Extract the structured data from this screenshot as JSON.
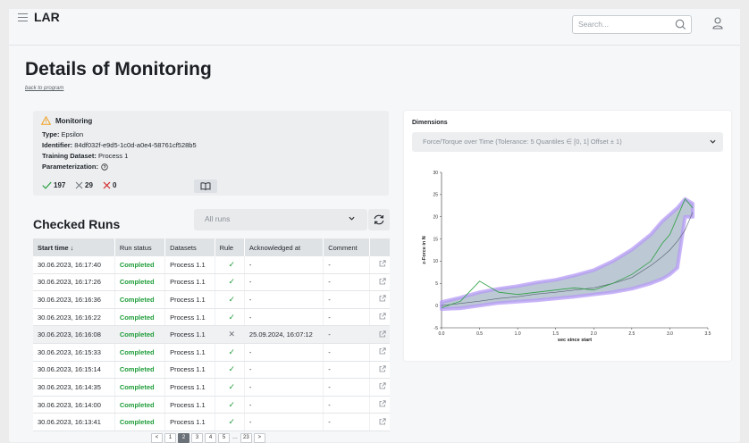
{
  "header": {
    "app_title": "LAR",
    "search_placeholder": "Search...",
    "menu_icon": "menu-icon",
    "search_icon": "search-icon",
    "user_icon": "user-icon"
  },
  "page": {
    "title": "Details of Monitoring",
    "back_link": "back to program"
  },
  "monitoring": {
    "heading": "Monitoring",
    "type_label": "Type:",
    "type_value": "Epsilon",
    "identifier_label": "Identifier:",
    "identifier_value": "84df032f-e9d5-1c0d-a0e4-58761cf528b5",
    "training_label": "Training Dataset:",
    "training_value": "Process 1",
    "param_label": "Parameterization:",
    "stats": {
      "checked": "197",
      "unchecked": "29",
      "failed": "0"
    },
    "colors": {
      "warning": "#f0a020",
      "ok": "#1f9d3a",
      "fail": "#d62828",
      "neutral": "#6b7178"
    }
  },
  "checked_runs": {
    "title": "Checked Runs",
    "filter_value": "All runs",
    "columns": [
      "Start time ↓",
      "Run status",
      "Datasets",
      "Rule",
      "Acknowledged at",
      "Comment"
    ],
    "rows": [
      {
        "start": "30.06.2023, 16:17:40",
        "status": "Completed",
        "dataset": "Process 1.1",
        "rule": "✓",
        "ack": "-",
        "comment": "-"
      },
      {
        "start": "30.06.2023, 16:17:26",
        "status": "Completed",
        "dataset": "Process 1.1",
        "rule": "✓",
        "ack": "-",
        "comment": "-"
      },
      {
        "start": "30.06.2023, 16:16:36",
        "status": "Completed",
        "dataset": "Process 1.1",
        "rule": "✓",
        "ack": "-",
        "comment": "-"
      },
      {
        "start": "30.06.2023, 16:16:22",
        "status": "Completed",
        "dataset": "Process 1.1",
        "rule": "✓",
        "ack": "-",
        "comment": "-"
      },
      {
        "start": "30.06.2023, 16:16:08",
        "status": "Completed",
        "dataset": "Process 1.1",
        "rule": "✕",
        "ack": "25.09.2024, 16:07:12",
        "comment": "-"
      },
      {
        "start": "30.06.2023, 16:15:33",
        "status": "Completed",
        "dataset": "Process 1.1",
        "rule": "✓",
        "ack": "-",
        "comment": "-"
      },
      {
        "start": "30.06.2023, 16:15:14",
        "status": "Completed",
        "dataset": "Process 1.1",
        "rule": "✓",
        "ack": "-",
        "comment": "-"
      },
      {
        "start": "30.06.2023, 16:14:35",
        "status": "Completed",
        "dataset": "Process 1.1",
        "rule": "✓",
        "ack": "-",
        "comment": "-"
      },
      {
        "start": "30.06.2023, 16:14:00",
        "status": "Completed",
        "dataset": "Process 1.1",
        "rule": "✓",
        "ack": "-",
        "comment": "-"
      },
      {
        "start": "30.06.2023, 16:13:41",
        "status": "Completed",
        "dataset": "Process 1.1",
        "rule": "✓",
        "ack": "-",
        "comment": "-"
      }
    ],
    "pagination": {
      "prev": "<",
      "pages": [
        "1",
        "2",
        "3",
        "4",
        "5"
      ],
      "active": "2",
      "ellipsis": "...",
      "last": "23",
      "next": ">"
    }
  },
  "dimensions": {
    "title": "Dimensions",
    "selected": "Force/Torque over Time (Tolerance: 5 Quantiles ∈ [0, 1] Offset ± 1)"
  },
  "chart_data": {
    "type": "line",
    "xlabel": "sec since start",
    "ylabel": "z-Force in N",
    "xlim": [
      0,
      3.5
    ],
    "ylim": [
      -5,
      30
    ],
    "xticks": [
      "0.0",
      "0.5",
      "1.0",
      "1.5",
      "2.0",
      "2.5",
      "3.0",
      "3.5"
    ],
    "yticks": [
      "-5",
      "0",
      "5",
      "10",
      "15",
      "20",
      "25",
      "30"
    ],
    "x": [
      0.0,
      0.25,
      0.5,
      0.75,
      1.0,
      1.25,
      1.5,
      1.75,
      2.0,
      2.25,
      2.5,
      2.75,
      2.9,
      3.0,
      3.1,
      3.2,
      3.3
    ],
    "series": [
      {
        "values": [
          0.0,
          0.5,
          1.0,
          1.6,
          2.0,
          2.6,
          3.0,
          3.5,
          4.0,
          5.0,
          6.3,
          9.0,
          11.0,
          12.5,
          14.5,
          17.0,
          21.0
        ],
        "color": "#556270"
      },
      {
        "values": [
          -0.5,
          1.0,
          5.5,
          3.0,
          2.5,
          3.0,
          3.5,
          4.0,
          3.5,
          5.0,
          7.0,
          10.0,
          14.0,
          16.0,
          20.0,
          24.0,
          22.0
        ],
        "color": "#2ea043"
      }
    ],
    "band": {
      "upper": [
        0.8,
        1.8,
        3.0,
        3.8,
        4.4,
        5.2,
        5.8,
        6.8,
        8.0,
        10.0,
        12.6,
        16.0,
        19.0,
        20.5,
        22.0,
        24.0,
        23.0
      ],
      "lower": [
        -0.8,
        -0.6,
        0.0,
        0.6,
        0.9,
        1.2,
        1.6,
        2.0,
        2.5,
        3.0,
        3.8,
        5.0,
        6.0,
        7.0,
        8.5,
        20.0,
        20.0
      ],
      "fill": "#a6b6c6",
      "edge": "#b59bf5"
    },
    "grid": false,
    "legend": "none"
  }
}
